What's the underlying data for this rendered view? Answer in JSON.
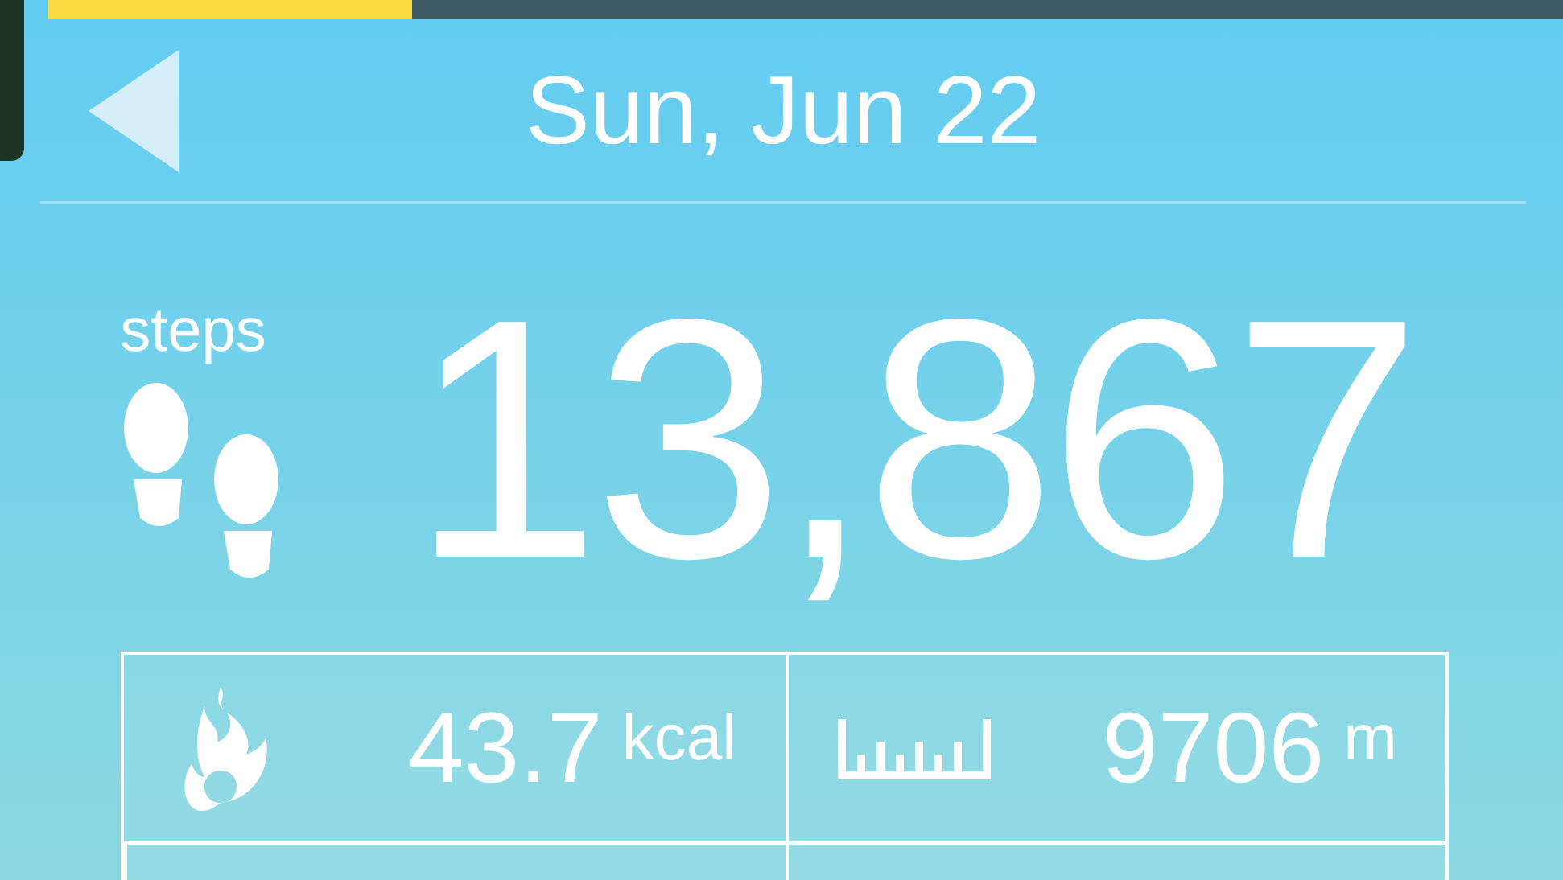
{
  "goal_progress": {
    "level": 0.24
  },
  "header": {
    "title": "Sun, Jun 22"
  },
  "steps": {
    "label": "steps",
    "value": "13,867"
  },
  "stats": [
    {
      "kind": "calories",
      "value": "43.7",
      "unit": "kcal"
    },
    {
      "kind": "distance",
      "value": "9706",
      "unit": "m"
    }
  ]
}
